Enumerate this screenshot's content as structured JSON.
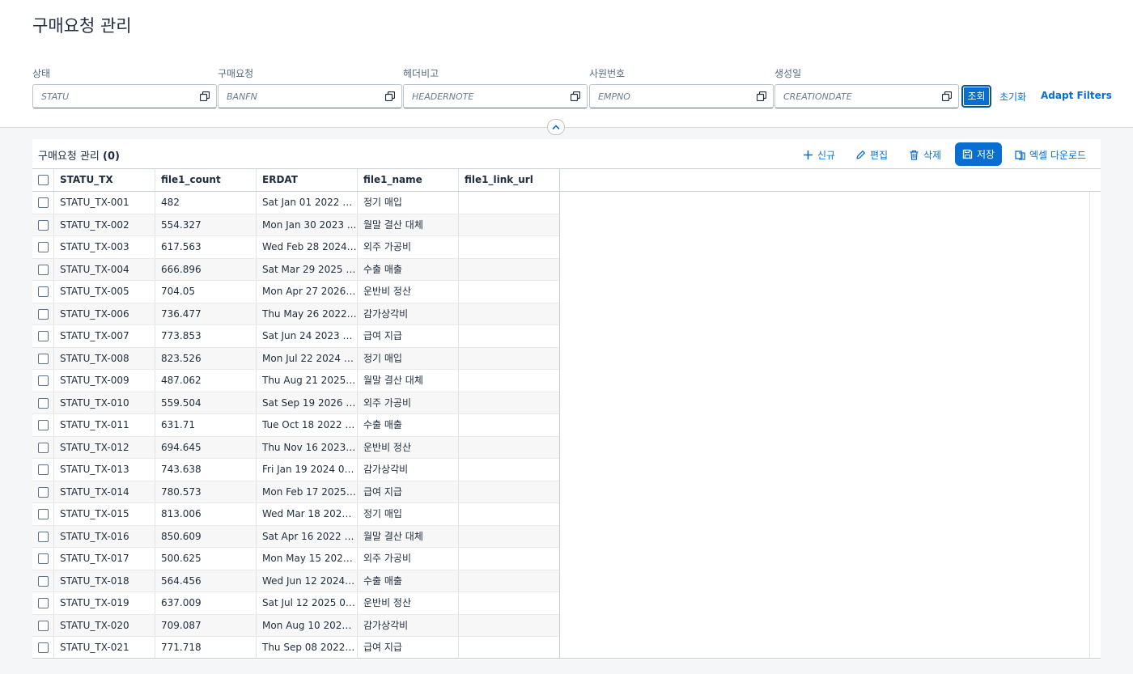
{
  "page": {
    "title": "구매요청 관리"
  },
  "filters": [
    {
      "label": "상태",
      "placeholder": "STATU"
    },
    {
      "label": "구매요청",
      "placeholder": "BANFN"
    },
    {
      "label": "헤더비고",
      "placeholder": "HEADERNOTE"
    },
    {
      "label": "사원번호",
      "placeholder": "EMPNO"
    },
    {
      "label": "생성일",
      "placeholder": "CREATIONDATE"
    }
  ],
  "filterbar": {
    "go_label": "조회",
    "clear_label": "초기화",
    "adapt_label": "Adapt Filters"
  },
  "table": {
    "title": "구매요청 관리",
    "count": "(0)",
    "toolbar": {
      "new_label": "신규",
      "edit_label": "편집",
      "delete_label": "삭제",
      "save_label": "저장",
      "excel_label": "엑셀 다운로드"
    },
    "columns": [
      "STATU_TX",
      "file1_count",
      "ERDAT",
      "file1_name",
      "file1_link_url"
    ],
    "rows": [
      [
        "STATU_TX-001",
        "482",
        "Sat Jan 01 2022 0...",
        "정기 매입",
        ""
      ],
      [
        "STATU_TX-002",
        "554.327",
        "Mon Jan 30 2023 ...",
        "월말 결산 대체",
        ""
      ],
      [
        "STATU_TX-003",
        "617.563",
        "Wed Feb 28 2024 ...",
        "외주 가공비",
        ""
      ],
      [
        "STATU_TX-004",
        "666.896",
        "Sat Mar 29 2025 0...",
        "수출 매출",
        ""
      ],
      [
        "STATU_TX-005",
        "704.05",
        "Mon Apr 27 2026 ...",
        "운반비 정산",
        ""
      ],
      [
        "STATU_TX-006",
        "736.477",
        "Thu May 26 2022 ...",
        "감가상각비",
        ""
      ],
      [
        "STATU_TX-007",
        "773.853",
        "Sat Jun 24 2023 0...",
        "급여 지급",
        ""
      ],
      [
        "STATU_TX-008",
        "823.526",
        "Mon Jul 22 2024 0...",
        "정기 매입",
        ""
      ],
      [
        "STATU_TX-009",
        "487.062",
        "Thu Aug 21 2025 0...",
        "월말 결산 대체",
        ""
      ],
      [
        "STATU_TX-010",
        "559.504",
        "Sat Sep 19 2026 0...",
        "외주 가공비",
        ""
      ],
      [
        "STATU_TX-011",
        "631.71",
        "Tue Oct 18 2022 0...",
        "수출 매출",
        ""
      ],
      [
        "STATU_TX-012",
        "694.645",
        "Thu Nov 16 2023 0...",
        "운반비 정산",
        ""
      ],
      [
        "STATU_TX-013",
        "743.638",
        "Fri Jan 19 2024 00...",
        "감가상각비",
        ""
      ],
      [
        "STATU_TX-014",
        "780.573",
        "Mon Feb 17 2025 ...",
        "급여 지급",
        ""
      ],
      [
        "STATU_TX-015",
        "813.006",
        "Wed Mar 18 2026 ...",
        "정기 매입",
        ""
      ],
      [
        "STATU_TX-016",
        "850.609",
        "Sat Apr 16 2022 0...",
        "월말 결산 대체",
        ""
      ],
      [
        "STATU_TX-017",
        "500.625",
        "Mon May 15 2023 ...",
        "외주 가공비",
        ""
      ],
      [
        "STATU_TX-018",
        "564.456",
        "Wed Jun 12 2024 ...",
        "수출 매출",
        ""
      ],
      [
        "STATU_TX-019",
        "637.009",
        "Sat Jul 12 2025 00...",
        "운반비 정산",
        ""
      ],
      [
        "STATU_TX-020",
        "709.087",
        "Mon Aug 10 2026 ...",
        "감가상각비",
        ""
      ],
      [
        "STATU_TX-021",
        "771.718",
        "Thu Sep 08 2022 0...",
        "급여 지급",
        ""
      ]
    ]
  },
  "colors": {
    "accent": "#0a6ed1",
    "text": "#1d2d3e",
    "label": "#556b82"
  }
}
